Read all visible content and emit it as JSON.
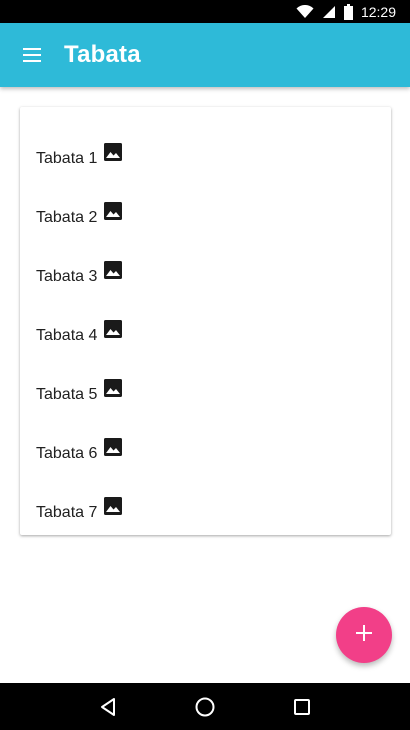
{
  "status_bar": {
    "time": "12:29",
    "icons": [
      "wifi-icon",
      "signal-icon",
      "battery-icon"
    ]
  },
  "app_bar": {
    "title": "Tabata",
    "menu_icon": "hamburger-menu-icon",
    "background_color": "#2ebad8"
  },
  "list": {
    "items": [
      {
        "label": "Tabata 1",
        "icon": "image-icon"
      },
      {
        "label": "Tabata 2",
        "icon": "image-icon"
      },
      {
        "label": "Tabata 3",
        "icon": "image-icon"
      },
      {
        "label": "Tabata 4",
        "icon": "image-icon"
      },
      {
        "label": "Tabata 5",
        "icon": "image-icon"
      },
      {
        "label": "Tabata 6",
        "icon": "image-icon"
      },
      {
        "label": "Tabata 7",
        "icon": "image-icon"
      }
    ]
  },
  "fab": {
    "icon": "add-icon",
    "color": "#f23f88"
  },
  "nav_bar": {
    "icons": [
      "back-icon",
      "home-icon",
      "recents-icon"
    ]
  }
}
